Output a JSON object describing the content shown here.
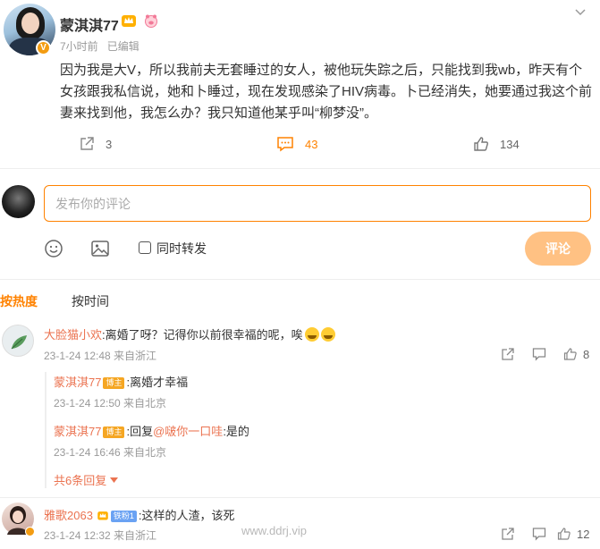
{
  "post": {
    "author": "蒙淇淇77",
    "verified_badge": "V",
    "time": "7小时前",
    "edited": "已编辑",
    "content": "因为我是大V，所以我前夫无套睡过的女人，被他玩失踪之后，只能找到我wb，昨天有个女孩跟我私信说，她和卜睡过，现在发现感染了HIV病毒。卜已经消失，她要通过我这个前妻来找到他，我怎么办？我只知道他某乎叫“柳梦没”。",
    "actions": {
      "share_count": "3",
      "comment_count": "43",
      "like_count": "134"
    },
    "accent": "#ff8200"
  },
  "composer": {
    "placeholder": "发布你的评论",
    "repost_label": "同时转发",
    "submit_label": "评论",
    "icons": [
      "emoji-icon",
      "image-icon"
    ]
  },
  "sort": {
    "hot": "按热度",
    "time": "按时间"
  },
  "comments": [
    {
      "name": "大脸猫小欢",
      "text": ":离婚了呀？记得你以前很幸福的呢，唉",
      "time": "23-1-24 12:48 来自浙江",
      "likes": "8",
      "replies": [
        {
          "name": "蒙淇淇77",
          "tag": "博主",
          "text": ":离婚才幸福",
          "time": "23-1-24 12:50 来自北京"
        },
        {
          "name": "蒙淇淇77",
          "tag": "博主",
          "text_prefix": ":回复",
          "mention": "@啵你一口哇",
          "text_suffix": ":是的",
          "time": "23-1-24 16:46 来自北京"
        }
      ],
      "more": "共6条回复"
    },
    {
      "name": "雅歌2063",
      "tag": "铁粉1",
      "text": ":这样的人渣，该死",
      "time": "23-1-24 12:32 来自浙江",
      "likes": "12"
    }
  ],
  "watermark": "www.ddrj.vip"
}
